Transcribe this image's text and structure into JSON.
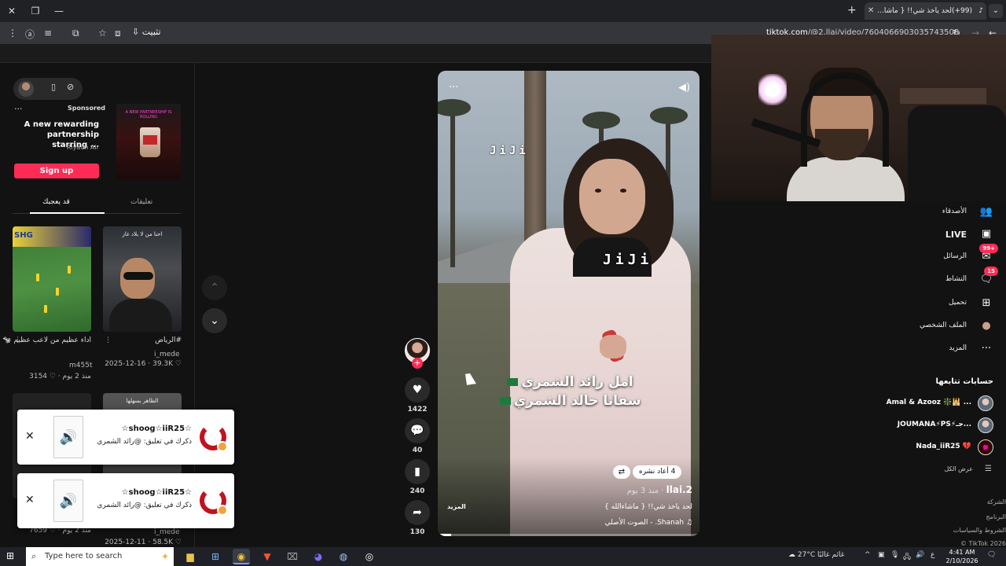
{
  "browser": {
    "tab_title": "(99+)لحد ياخذ شي!! { ماشا...",
    "new_tab": "+",
    "url_host": "tiktok.com",
    "url_path": "/@2.llai/video/7604066903035743508",
    "install_label": "تثبيت",
    "window_controls": [
      "✕",
      "❐",
      "—"
    ]
  },
  "left": {
    "ad": {
      "sponsored": "Sponsored",
      "dots": "···",
      "text": "A new rewarding partnership starring ...",
      "brand": "Riyadh Air",
      "cta": "Sign up",
      "image_caption": "A NEW PARTNERSHIP IS ROLLING"
    },
    "tabs": {
      "comments": "تعليقات",
      "you_may_like": "قد يعجبك"
    },
    "videos": [
      {
        "title": "اداء عظيم من لاعب عظيم 🐄 النسر...",
        "author": "m455t",
        "likes": "3154",
        "age": "منذ 2 يوم"
      },
      {
        "title": "#الرياض",
        "author": "i_mede",
        "likes": "39.3K",
        "date": "2025-12-16",
        "overlay": "احنا من لا بلاد غاز"
      },
      {
        "title": "",
        "author": "i_mede",
        "likes": "7659",
        "age": "منذ 2 يوم"
      },
      {
        "title": "",
        "author": "",
        "likes": "58.5K",
        "date": "2025-12-11",
        "overlay": "الظاهر بسهلها"
      }
    ]
  },
  "toasts": [
    {
      "title": "☆shoog☆iiR25☆",
      "subtitle": "ذكرك في تعليق: @رائد الشمري"
    },
    {
      "title": "☆shoog☆iiR25☆",
      "subtitle": "ذكرك في تعليق: @رائد الشمري"
    }
  ],
  "video": {
    "overlay_small": "JiJi",
    "overlay_large": "JiJi",
    "caption_line1": "امل رائد الشمري",
    "caption_line2": "سفانا خالد الشمري",
    "reposts": "4 أعاد نشره",
    "author": "llai.2",
    "age": "منذ 3 يوم",
    "description": "لحد ياخذ شي!! { ماشاءالله }",
    "more": "المزيد",
    "music": "♫ Shanah. - الصوت الأصلي",
    "progress": 0.05
  },
  "actions": {
    "likes": "1422",
    "comments": "40",
    "saves": "240",
    "shares": "130"
  },
  "right": {
    "nav": [
      {
        "label": "الأصدقاء",
        "icon": "friends-icon",
        "glyph": "👥"
      },
      {
        "label": "LIVE",
        "icon": "live-icon",
        "glyph": "▣"
      },
      {
        "label": "الرسائل",
        "icon": "messages-icon",
        "glyph": "✉",
        "badge": "99+"
      },
      {
        "label": "النشاط",
        "icon": "activity-icon",
        "glyph": "🗨",
        "badge": "15"
      },
      {
        "label": "تحميل",
        "icon": "upload-icon",
        "glyph": "⊞"
      },
      {
        "label": "الملف الشخصي",
        "icon": "profile-icon",
        "glyph": "●"
      },
      {
        "label": "المزيد",
        "icon": "more-icon",
        "glyph": "···"
      }
    ],
    "following_header": "حسابات تتابعها",
    "following": [
      "Amal & Azooz ❇️🕌 ...",
      "JOUMANA⚡PS⚡جـ...",
      "Nada_iiR25 💔"
    ],
    "see_all": "عرض الكل",
    "footer": [
      "الشركة",
      "البرنامج",
      "الشروط والسياسات",
      "TikTok 2026 ©"
    ]
  },
  "taskbar": {
    "search_placeholder": "Type here to search",
    "weather": "27°C  غائم غالبًا",
    "lang": "ع",
    "time": "4:41 AM",
    "date": "2/10/2026"
  },
  "colors": {
    "accent": "#fe2c55",
    "bg": "#121212"
  }
}
